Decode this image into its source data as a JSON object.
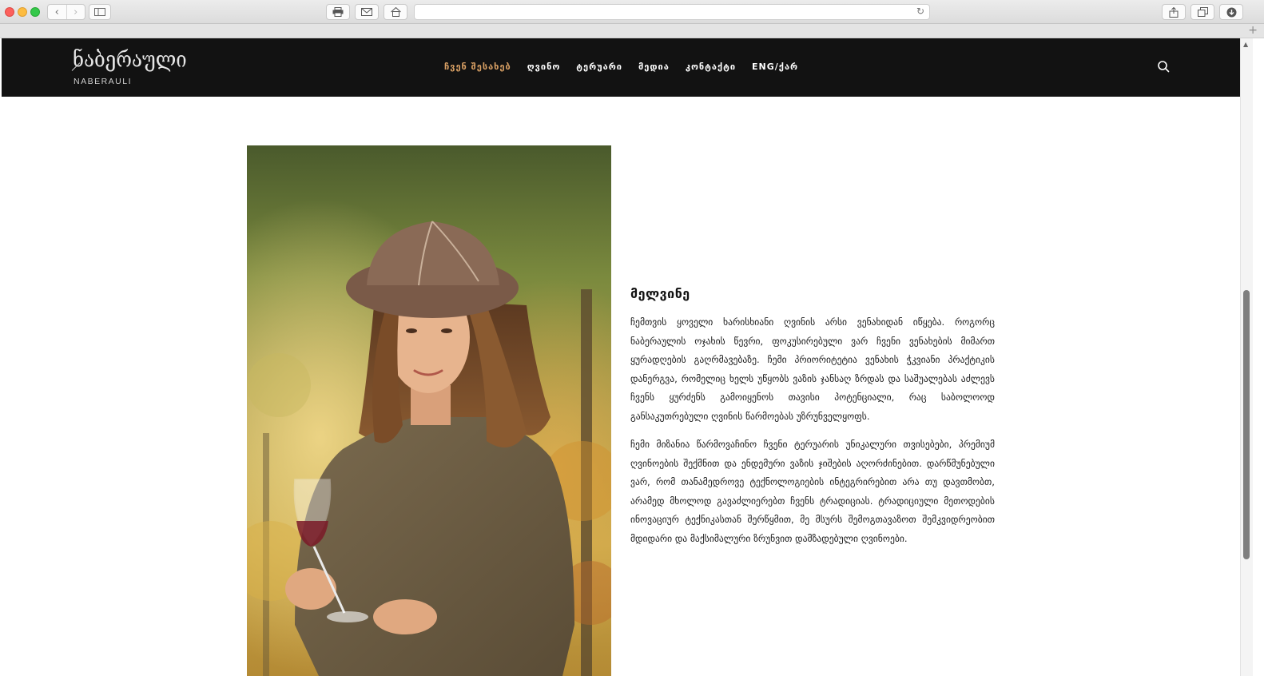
{
  "browser": {
    "back_icon": "chevron-left-icon",
    "forward_icon": "chevron-right-icon",
    "sidebar_icon": "sidebar-icon",
    "print_icon": "printer-icon",
    "mail_icon": "mail-icon",
    "home_icon": "home-icon",
    "reload_icon": "reload-icon",
    "share_icon": "share-icon",
    "tabs_icon": "tabs-icon",
    "download_icon": "download-icon",
    "new_tab_label": "+",
    "address_value": ""
  },
  "header": {
    "logo_georgian": "ნაბერაული",
    "logo_latin": "NABERAULI",
    "menu": [
      {
        "label": "ჩვენ შესახებ",
        "active": true
      },
      {
        "label": "ღვინო",
        "active": false
      },
      {
        "label": "ტერუარი",
        "active": false
      },
      {
        "label": "მედია",
        "active": false
      },
      {
        "label": "კონტაქტი",
        "active": false
      },
      {
        "label": "ENG/ქარ",
        "active": false
      }
    ],
    "search_icon": "search-icon",
    "accent_color": "#d9a064",
    "background_color": "#121212"
  },
  "content": {
    "photo_icon": "winemaker-portrait-image",
    "name": "მელვინე",
    "paragraphs": [
      "ჩემთვის ყოველი ხარისხიანი ღვინის არსი ვენახიდან იწყება. როგორც ნაბერაულის ოჯახის წევრი, ფოკუსირებული ვარ ჩვენი ვენახების მიმართ ყურადღების გაღრმავებაზე. ჩემი პრიორიტეტია ვენახის ჭკვიანი პრაქტიკის დანერგვა, რომელიც ხელს უწყობს ვაზის ჯანსაღ ზრდას და საშუალებას აძლევს ჩვენს ყურძენს გამოიყენოს თავისი პოტენციალი, რაც საბოლოოდ განსაკუთრებული ღვინის წარმოებას უზრუნველყოფს.",
      "ჩემი მიზანია წარმოვაჩინო ჩვენი ტერუარის უნიკალური თვისებები, პრემიუმ ღვინოების შექმნით და ენდემური ვაზის ჯიშების აღორძინებით. დარწმუნებული ვარ, რომ თანამედროვე ტექნოლოგიების ინტეგრირებით არა თუ დავთმობთ, არამედ მხოლოდ გავაძლიერებთ ჩვენს ტრადიციას. ტრადიციული მეთოდების ინოვაციურ ტექნიკასთან შერწყმით, მე მსურს შემოგთავაზოთ შემკვიდრეობით მდიდარი და მაქსიმალური ზრუნვით დამზადებული ღვინოები."
    ]
  }
}
